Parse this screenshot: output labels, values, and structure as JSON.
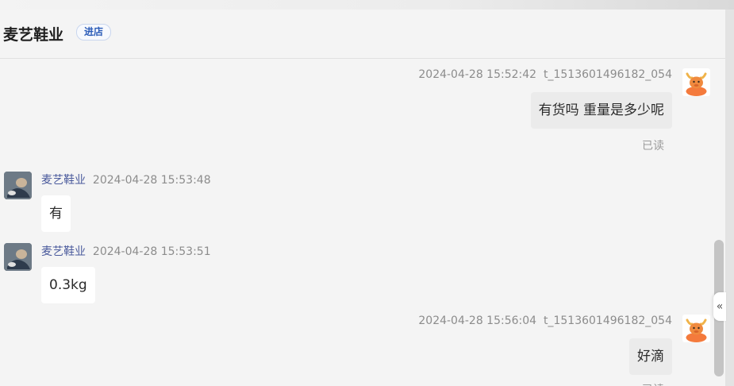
{
  "header": {
    "shop_name": "麦艺鞋业",
    "enter_label": "进店"
  },
  "messages": [
    {
      "timestamp": "2024-04-28 15:52:42",
      "sender": "t_1513601496182_054",
      "text": "有货吗 重量是多少呢",
      "status": "已读"
    },
    {
      "sender": "麦艺鞋业",
      "timestamp": "2024-04-28 15:53:48",
      "text": "有"
    },
    {
      "sender": "麦艺鞋业",
      "timestamp": "2024-04-28 15:53:51",
      "text": "0.3kg"
    },
    {
      "timestamp": "2024-04-28 15:56:04",
      "sender": "t_1513601496182_054",
      "text": "好滴",
      "status": "已读"
    }
  ],
  "sidebar": {
    "collapse_glyph": "«"
  },
  "colors": {
    "shop_link": "#4a5a9c",
    "enter_button_text": "#2b5cb8",
    "avatar_orange": "#f47a3c"
  },
  "icons": {
    "buyer_avatar": "orange-bull-avatar",
    "seller_avatar": "shop-photo-avatar"
  }
}
